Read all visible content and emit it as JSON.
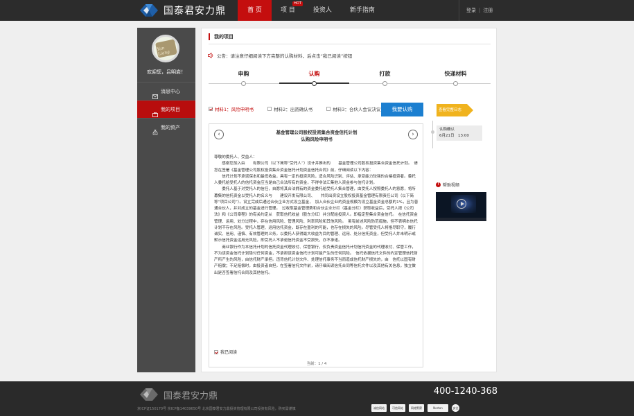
{
  "brand": {
    "name": "国泰君安力鼎",
    "logo_icon": "diamond-logo-icon"
  },
  "nav": {
    "items": [
      {
        "label": "首 页",
        "active": true
      },
      {
        "label": "项 目",
        "badge": "HOT"
      },
      {
        "label": "投资人"
      },
      {
        "label": "新手指南"
      }
    ]
  },
  "auth": {
    "login": "登录",
    "separator": "|",
    "register": "注册"
  },
  "sidebar": {
    "welcome": "欢迎您，吕明岩！",
    "avatar_signature": "Yan Liang",
    "items": [
      {
        "label": "消息中心",
        "icon": "mail-icon"
      },
      {
        "label": "我的项目",
        "icon": "project-icon",
        "active": true
      },
      {
        "label": "我的资产",
        "icon": "money-bag-icon"
      }
    ]
  },
  "main": {
    "title": "我的项目",
    "notice": "公告：请注意仔细阅读下方完整的认购材料，后点击“我已阅读”按钮",
    "steps": [
      {
        "label": "申购"
      },
      {
        "label": "认购",
        "active": true
      },
      {
        "label": "打款"
      },
      {
        "label": "快递材料"
      }
    ],
    "materials": [
      {
        "label": "材料1：风险申明书",
        "checked": true
      },
      {
        "label": "材料2：出资确认书",
        "checked": false
      },
      {
        "label": "材料3：合伙人会议决议",
        "checked": false
      }
    ],
    "buy_button": "我要认购",
    "document": {
      "title_line1": "基金管理公司股权投资集合资金信托计划",
      "title_line2": "认购风险申明书",
      "paragraphs": [
        "尊敬的委托人、受益人：",
        "　　感谢您加入由　　有限公司（以下简称“受托人”）设计并推出的　　基金管理公司股权投资集合资金信托计划。　请您在签署《基金管理公司股权投资集合资金信托计划资金信托合同》前，仔细阅读以下内容：",
        "　　信托计划不承诺保本和最低收益，具有一定的投资风险，适合风险识别、评估、承受能力较强的合格投资者。委托人委托给受托人的信托资金应当是自己合法所有的资金，不得非法汇集他人资金参与信托计划。",
        "　　委托人基于对受托人的信任，自愿将其合法拥有的资金委托给受托人集合管理，由受托人按照委托人的意愿，将所募集的信托资金以受托人的名义与　　建设开发有限公司、　　共同出资设立股权投资基金管理有限责任公司（以下简称“项目公司”）。设立完成后通过合伙企业方式设立基金，　加入合伙企业的资金规模为设立基金资金总额的1%，且为普通合伙人，并对成立的基金进行管理。　过收取基金管理费和合伙企业分红（基金分红）获取收益后，受托人按《公司法》和《公司章程》的有关约定从　获取信托收益（股东分红）并分配给投资人。即指定型集合资金信托。　在信托资金管理、运用、处分过程中，存在信用风险、管理风险、利率风险和其他风险。　虽有前述风险防范措施，但不表明本信托计划不存在风险。受托人管理、运用信托资金，既存在盈利的可能，也存在损失的风险。尽管受托人将恪尽职守，履行诚实、信用、谨慎、有效管理的义务，以委托人获得最大收益为目的管理、运用、处分信托资金，但受托人并未明示或默示信托资金运用无风险，即受托人不承诺信托资金不受损失，亦不承诺。",
        "　　商业银行作为本信托计划的信托资金代理收付、保管银行，仅负责资金信托计划信托资金的代理收付、保管工作，不为该资金信托计划垫付任何资金，不承担该资金信托计划可能产生的任何风险。　信托依据信托文件的约定管理信托财产所产生的风险，由信托财产承担。违背信托计划文件、处理信托事务不当而造成信托财产损失的，由　信托以固有财产赔偿；不足赔偿时，由投资者自担。在签署信托文件前，请仔细阅读信托合同等信托文件以及其他有关信息，独立做出是否签署信托合同及其他信托。"
      ],
      "read_label": "我已阅读",
      "read_checked": true,
      "pager": "当前：1 / 4"
    },
    "timeline": {
      "button": "查看完整日志",
      "event_title": "认购确认",
      "event_time": "6月21日　13:00"
    },
    "help": {
      "title": "帮助视频",
      "icon": "warning-icon"
    }
  },
  "footer": {
    "brand": "国泰君安力鼎",
    "phone": "400-1240-368",
    "legal": "京ICP证150170号  京ICP备14039650号  北京国泰君安力鼎投资管理有限公司投资有风险，购买需谨慎",
    "badges": [
      "诚信网站",
      "可信网站",
      "网络警察",
      "Norton",
      "安全"
    ]
  },
  "colors": {
    "brand_red": "#c40e0e",
    "button_blue": "#1c7fd0",
    "timeline_yellow": "#f0b31e",
    "dark": "#2c2c2c"
  }
}
